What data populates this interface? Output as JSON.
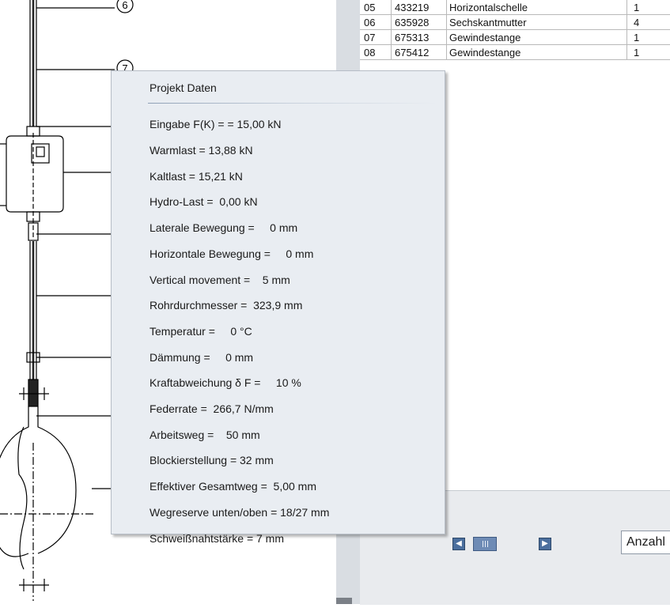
{
  "drawing": {
    "callouts": [
      "6",
      "7"
    ]
  },
  "parts_table": {
    "rows": [
      {
        "pos": "05",
        "article": "433219",
        "name": "Horizontalschelle",
        "qty": "1"
      },
      {
        "pos": "06",
        "article": "635928",
        "name": "Sechskantmutter",
        "qty": "4"
      },
      {
        "pos": "07",
        "article": "675313",
        "name": "Gewindestange",
        "qty": "1"
      },
      {
        "pos": "08",
        "article": "675412",
        "name": "Gewindestange",
        "qty": "1"
      }
    ]
  },
  "navigation": {
    "prev_icon": "arrow-left-icon",
    "next_icon": "arrow-right-icon",
    "anzahl_label": "Anzahl"
  },
  "project_data": {
    "title": "Projekt Daten",
    "items": [
      "Eingabe F(K) = = 15,00 kN",
      "Warmlast = 13,88 kN",
      "Kaltlast = 15,21 kN",
      "Hydro-Last =  0,00 kN",
      "Laterale Bewegung =     0 mm",
      "Horizontale Bewegung =     0 mm",
      "Vertical movement =    5 mm",
      "Rohrdurchmesser =  323,9 mm",
      "Temperatur =     0 °C",
      "Dämmung =     0 mm",
      "Kraftabweichung δ F =     10 %",
      "Federrate =  266,7 N/mm",
      "Arbeitsweg =    50 mm",
      "Blockierstellung = 32 mm",
      "Effektiver Gesamtweg =  5,00 mm",
      "Wegreserve unten/oben = 18/27 mm",
      "Schweißnahtstärke = 7 mm"
    ]
  },
  "colors": {
    "popup_background": "#e9edf2",
    "nav_button": "#4b6f9e",
    "divider": "#d9dde2"
  }
}
